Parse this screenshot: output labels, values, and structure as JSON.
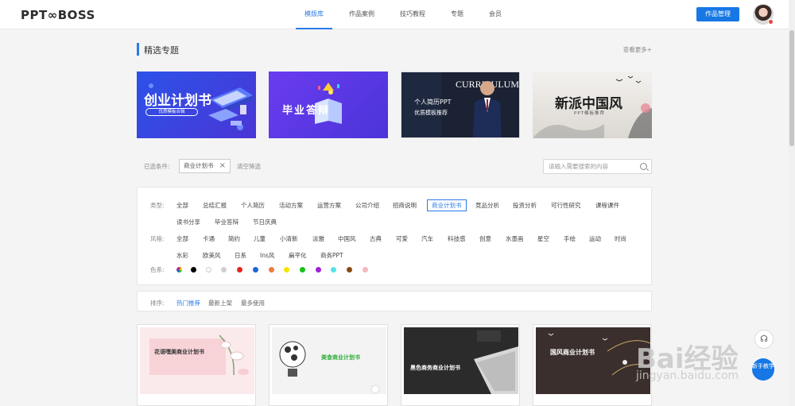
{
  "header": {
    "logo": "PPT∞BOSS",
    "nav": [
      "模版库",
      "作品案例",
      "技巧教程",
      "专题",
      "会员"
    ],
    "active_nav": "模版库",
    "manage_button": "作品管理"
  },
  "featured": {
    "title": "精选专题",
    "more": "查看更多+",
    "banners": [
      {
        "title": "创业计划书",
        "subtitle": "优质模板合辑"
      },
      {
        "title": "毕业答辩"
      },
      {
        "title": "个人简历PPT",
        "subtitle": "优质模板推荐",
        "overlay": "CURRICULUM"
      },
      {
        "title": "新派中国风",
        "subtitle": "PPT模板推荐"
      }
    ]
  },
  "filters": {
    "selected_label": "已选条件:",
    "selected_chip": "商业计划书",
    "clear": "清空筛选",
    "search_placeholder": "请输入需要搜索的内容"
  },
  "categories": {
    "type_label": "类型:",
    "types": [
      "全部",
      "总结汇报",
      "个人简历",
      "活动方案",
      "运营方案",
      "公司介绍",
      "招商说明",
      "商业计划书",
      "竞品分析",
      "投资分析",
      "可行性研究",
      "课程课件",
      "读书分享",
      "毕业答辩",
      "节日庆典"
    ],
    "selected_type": "商业计划书",
    "style_label": "风格:",
    "styles": [
      "全部",
      "卡通",
      "简约",
      "儿童",
      "小清新",
      "淡雅",
      "中国风",
      "古典",
      "可爱",
      "汽车",
      "科技感",
      "创意",
      "水墨画",
      "星空",
      "手绘",
      "运动",
      "时尚",
      "水彩",
      "欧美风",
      "日系",
      "Ins风",
      "扁平化",
      "商务PPT"
    ],
    "color_label": "色系:",
    "colors": [
      "multicolor",
      "#000000",
      "#ffffff",
      "#cfcfcf",
      "#e8231d",
      "#1f64d9",
      "#f07a3e",
      "#f4e500",
      "#19c11a",
      "#a120d8",
      "#53e3e3",
      "#8a4a12",
      "#f4b9c0"
    ]
  },
  "sort": {
    "label": "排序:",
    "options": [
      "热门推荐",
      "最新上架",
      "最多使用"
    ],
    "active": "热门推荐"
  },
  "cards": [
    {
      "title": "花语嘿美商业计划书"
    },
    {
      "title": "美食商业计划书"
    },
    {
      "title": "黑色商务商业计划书"
    },
    {
      "title": "国风商业计划书"
    }
  ],
  "side": {
    "newbie": "新手教学"
  },
  "watermark": {
    "brand": "Bai经验",
    "url": "jingyan.baidu.com"
  }
}
